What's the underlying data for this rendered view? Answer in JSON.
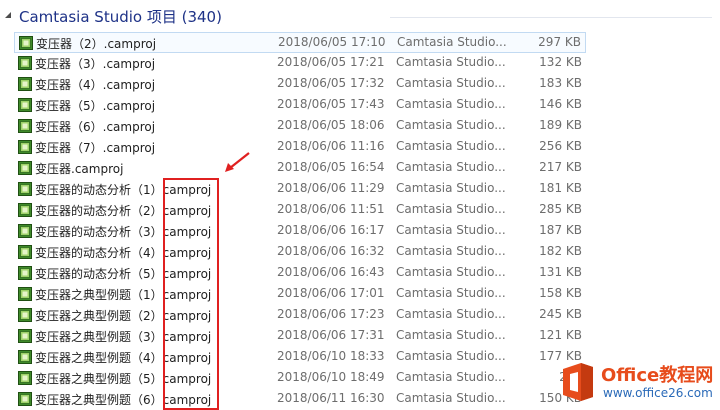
{
  "group": {
    "title": "Camtasia Studio 项目 (340)"
  },
  "files": [
    {
      "name_base": "变压器（2）",
      "name_ext": ".camproj",
      "date": "2018/06/05 17:10",
      "type": "Camtasia Studio...",
      "size": "297 KB",
      "selected": true
    },
    {
      "name_base": "变压器（3）",
      "name_ext": ".camproj",
      "date": "2018/06/05 17:21",
      "type": "Camtasia Studio...",
      "size": "132 KB"
    },
    {
      "name_base": "变压器（4）",
      "name_ext": ".camproj",
      "date": "2018/06/05 17:32",
      "type": "Camtasia Studio...",
      "size": "183 KB"
    },
    {
      "name_base": "变压器（5）",
      "name_ext": ".camproj",
      "date": "2018/06/05 17:43",
      "type": "Camtasia Studio...",
      "size": "146 KB"
    },
    {
      "name_base": "变压器（6）",
      "name_ext": ".camproj",
      "date": "2018/06/05 18:06",
      "type": "Camtasia Studio...",
      "size": "189 KB"
    },
    {
      "name_base": "变压器（7）",
      "name_ext": ".camproj",
      "date": "2018/06/06 11:16",
      "type": "Camtasia Studio...",
      "size": "256 KB"
    },
    {
      "name_base": "变压器",
      "name_ext": ".camproj",
      "date": "2018/06/05 16:54",
      "type": "Camtasia Studio...",
      "size": "217 KB"
    },
    {
      "name_base": "变压器的动态分析（1）",
      "name_ext": "camproj",
      "date": "2018/06/06 11:29",
      "type": "Camtasia Studio...",
      "size": "181 KB"
    },
    {
      "name_base": "变压器的动态分析（2）",
      "name_ext": "camproj",
      "date": "2018/06/06 11:51",
      "type": "Camtasia Studio...",
      "size": "285 KB"
    },
    {
      "name_base": "变压器的动态分析（3）",
      "name_ext": "camproj",
      "date": "2018/06/06 16:17",
      "type": "Camtasia Studio...",
      "size": "187 KB"
    },
    {
      "name_base": "变压器的动态分析（4）",
      "name_ext": "camproj",
      "date": "2018/06/06 16:32",
      "type": "Camtasia Studio...",
      "size": "182 KB"
    },
    {
      "name_base": "变压器的动态分析（5）",
      "name_ext": "camproj",
      "date": "2018/06/06 16:43",
      "type": "Camtasia Studio...",
      "size": "131 KB"
    },
    {
      "name_base": "变压器之典型例题（1）",
      "name_ext": "camproj",
      "date": "2018/06/06 17:01",
      "type": "Camtasia Studio...",
      "size": "158 KB"
    },
    {
      "name_base": "变压器之典型例题（2）",
      "name_ext": "camproj",
      "date": "2018/06/06 17:23",
      "type": "Camtasia Studio...",
      "size": "245 KB"
    },
    {
      "name_base": "变压器之典型例题（3）",
      "name_ext": "camproj",
      "date": "2018/06/06 17:31",
      "type": "Camtasia Studio...",
      "size": "121 KB"
    },
    {
      "name_base": "变压器之典型例题（4）",
      "name_ext": "camproj",
      "date": "2018/06/10 18:33",
      "type": "Camtasia Studio...",
      "size": "177 KB"
    },
    {
      "name_base": "变压器之典型例题（5）",
      "name_ext": "camproj",
      "date": "2018/06/10 18:49",
      "type": "Camtasia Studio...",
      "size": "267"
    },
    {
      "name_base": "变压器之典型例题（6）",
      "name_ext": "camproj",
      "date": "2018/06/11 16:30",
      "type": "Camtasia Studio...",
      "size": "150 KB"
    }
  ],
  "watermark": {
    "title": "Office教程网",
    "url": "www.office26.com"
  },
  "colors": {
    "group_title": "#1e3287",
    "highlight_box": "#e02020",
    "icon_fill": "#3f8a2a",
    "watermark_orange": "#e74c1c"
  },
  "icons": {
    "collapse": "chevron-collapse-icon",
    "file": "camproj-file-icon",
    "logo": "office-logo-icon"
  }
}
